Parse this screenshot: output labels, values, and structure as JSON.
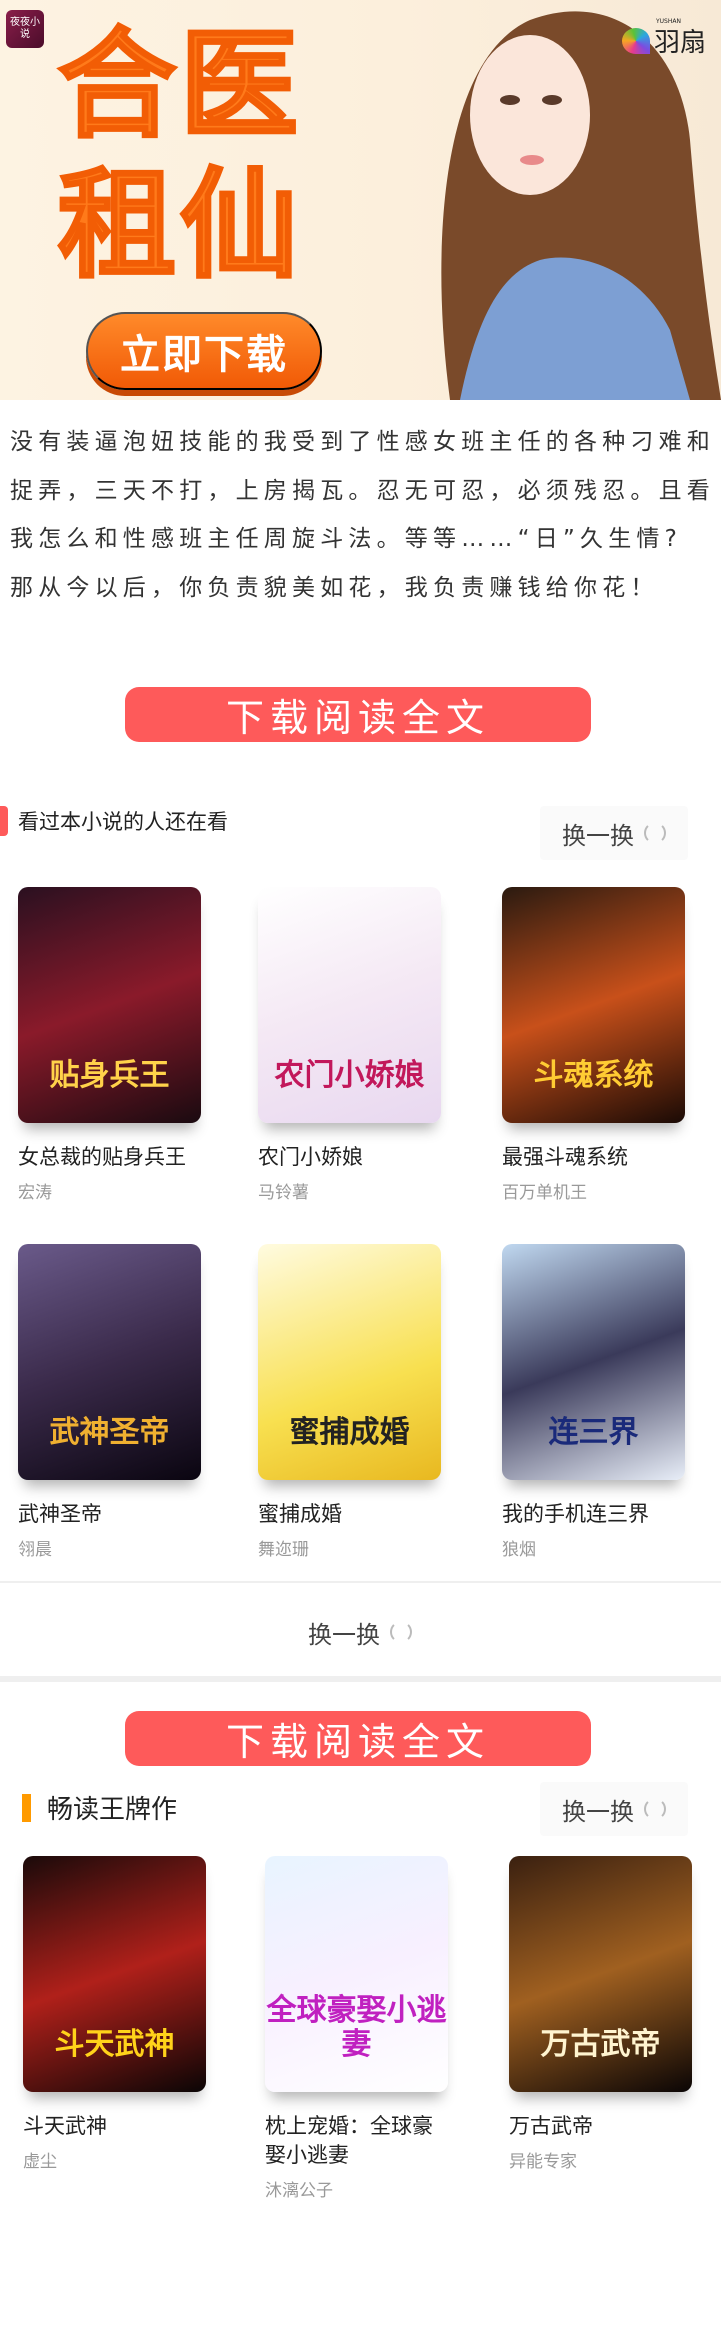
{
  "banner": {
    "app_logo": "夜夜小说",
    "title_line1": "合医",
    "title_line2": "租仙",
    "download_label": "立即下载",
    "brand": "羽扇",
    "brand_en": "YUSHAN"
  },
  "intro": {
    "paragraph1": "没有装逼泡妞技能的我受到了性感女班主任的各种刁难和捉弄，三天不打，上房揭瓦。忍无可忍，必须残忍。且看我怎么和性感班主任周旋斗法。等等……“日”久生情?",
    "paragraph2": "那从今以后，你负责貌美如花，我负责赚钱给你花！"
  },
  "cta_label": "下载阅读全文",
  "section1": {
    "title": "看过本小说的人还在看",
    "swap_label": "换一换",
    "accent": "#fe5a5a",
    "books": [
      {
        "title": "女总裁的贴身兵王",
        "author": "宏涛",
        "cover_text": "贴身兵王"
      },
      {
        "title": "农门小娇娘",
        "author": "马铃薯",
        "cover_text": "农门小娇娘"
      },
      {
        "title": "最强斗魂系统",
        "author": "百万单机王",
        "cover_text": "斗魂系统"
      },
      {
        "title": "武神圣帝",
        "author": "翎晨",
        "cover_text": "武神圣帝"
      },
      {
        "title": "蜜捕成婚",
        "author": "舞迩珊",
        "cover_text": "蜜捕成婚"
      },
      {
        "title": "我的手机连三界",
        "author": "狼烟",
        "cover_text": "连三界"
      }
    ],
    "bottom_swap_label": "换一换"
  },
  "section2": {
    "title": "畅读王牌作",
    "swap_label": "换一换",
    "accent": "#ff9a00",
    "books": [
      {
        "title": "斗天武神",
        "author": "虚尘",
        "cover_text": "斗天武神"
      },
      {
        "title": "枕上宠婚：全球豪娶小逃妻",
        "author": "沐漓公子",
        "cover_text": "全球豪娶小逃妻"
      },
      {
        "title": "万古武帝",
        "author": "异能专家",
        "cover_text": "万古武帝"
      }
    ]
  }
}
